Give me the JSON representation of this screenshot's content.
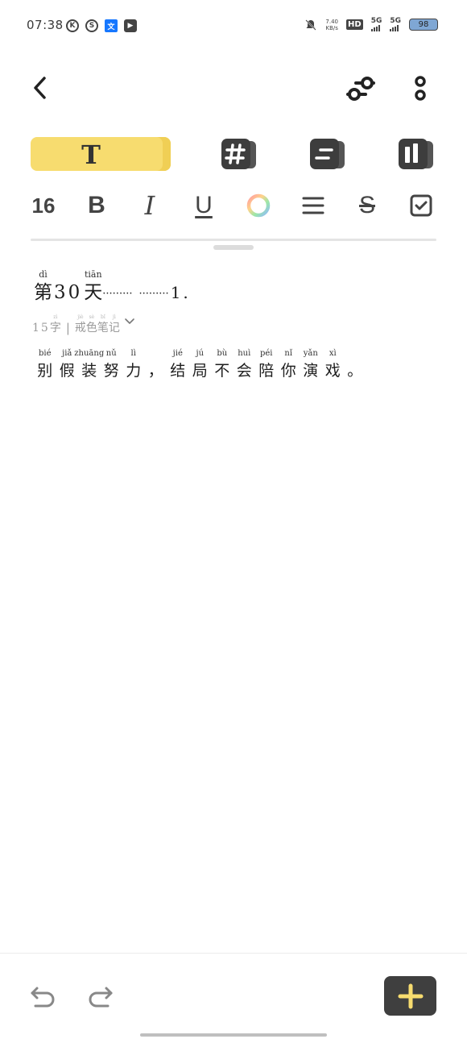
{
  "status_bar": {
    "time": "07:38",
    "app_icons": [
      "K",
      "S",
      "文",
      "▶"
    ],
    "net_speed_value": "7.40",
    "net_speed_unit": "KB/s",
    "hd_label": "HD",
    "sim1_label": "5G",
    "sim2_label": "5G",
    "battery": "98"
  },
  "toolbar": {
    "text_mode_label": "T"
  },
  "format": {
    "font_size": "16",
    "bold": "B",
    "italic": "I",
    "underline": "U",
    "strike": "S",
    "accent_color": "#f7dc6f"
  },
  "note": {
    "title": {
      "ch1": "第",
      "py1": "dì",
      "num": "30",
      "ch2": "天",
      "py2": "tiān",
      "dots1": "·········",
      "dots2": "·········",
      "end": "1."
    },
    "meta": {
      "count": "15",
      "unit": "字",
      "unit_py": "zì",
      "sep": "|",
      "category": [
        "戒",
        "色",
        "笔",
        "记"
      ],
      "category_py": [
        "jiè",
        "sè",
        "bǐ",
        "jì"
      ]
    },
    "body": [
      {
        "c": "别",
        "p": "bié"
      },
      {
        "c": "假",
        "p": "jiǎ"
      },
      {
        "c": "装",
        "p": "zhuāng"
      },
      {
        "c": "努",
        "p": "nǔ"
      },
      {
        "c": "力",
        "p": "lì"
      },
      {
        "c": "，",
        "p": ""
      },
      {
        "c": "结",
        "p": "jié"
      },
      {
        "c": "局",
        "p": "jú"
      },
      {
        "c": "不",
        "p": "bù"
      },
      {
        "c": "会",
        "p": "huì"
      },
      {
        "c": "陪",
        "p": "péi"
      },
      {
        "c": "你",
        "p": "nǐ"
      },
      {
        "c": "演",
        "p": "yǎn"
      },
      {
        "c": "戏",
        "p": "xì"
      },
      {
        "c": "。",
        "p": ""
      }
    ]
  }
}
